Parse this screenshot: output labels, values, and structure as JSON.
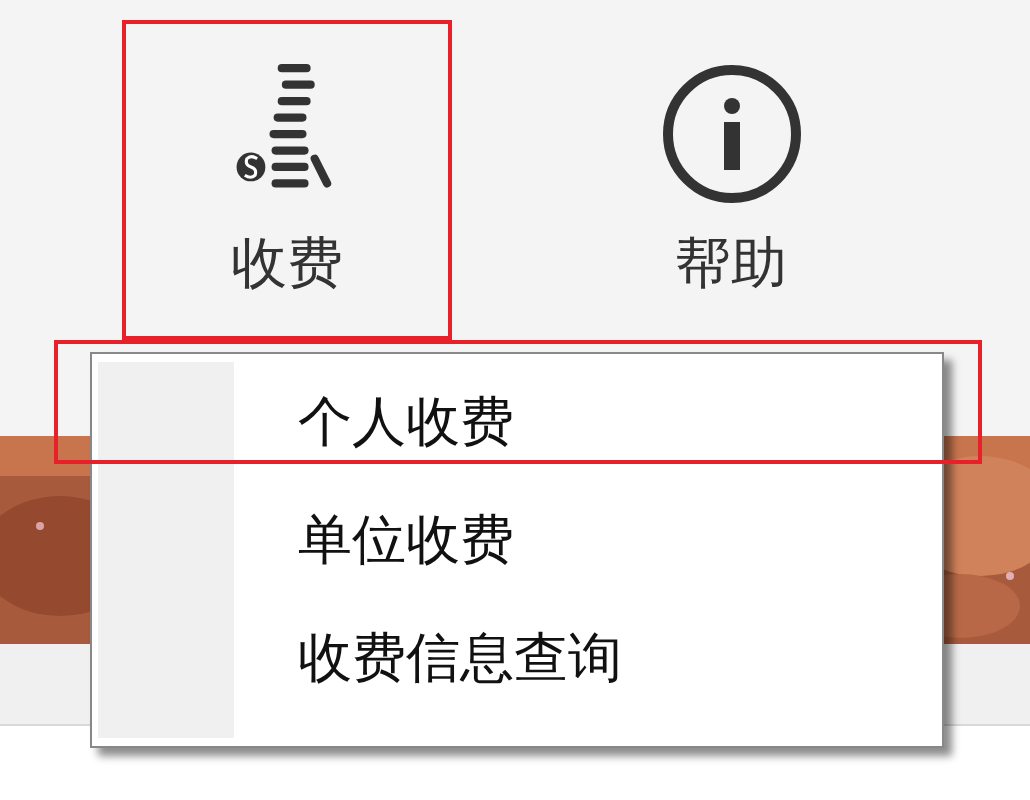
{
  "toolbar": {
    "buttons": [
      {
        "label": "收费",
        "kind": "coins",
        "highlighted": true
      },
      {
        "label": "帮助",
        "kind": "info",
        "highlighted": false
      }
    ]
  },
  "dropdown_menu": {
    "items": [
      {
        "label": "个人收费",
        "highlighted": true
      },
      {
        "label": "单位收费",
        "highlighted": false
      },
      {
        "label": "收费信息查询",
        "highlighted": false
      }
    ]
  }
}
